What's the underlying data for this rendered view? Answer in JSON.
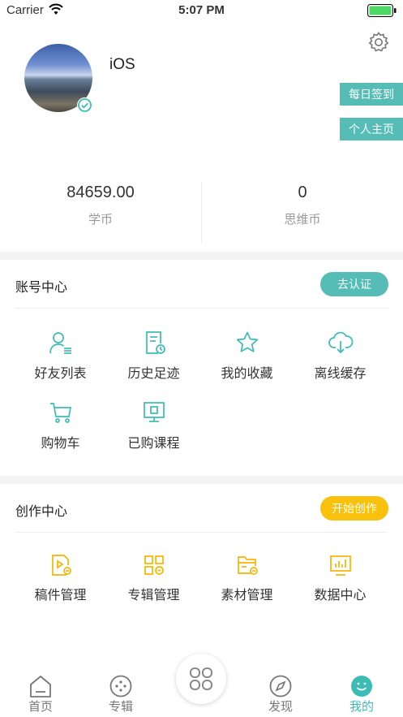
{
  "status_bar": {
    "carrier": "Carrier",
    "time": "5:07 PM"
  },
  "profile": {
    "username": "iOS",
    "daily_checkin_label": "每日签到",
    "homepage_label": "个人主页",
    "stats": [
      {
        "value": "84659.00",
        "label": "学币"
      },
      {
        "value": "0",
        "label": "思维币"
      }
    ]
  },
  "account_center": {
    "title": "账号中心",
    "action_label": "去认证",
    "accent_color": "#55bdb6",
    "items": [
      {
        "label": "好友列表",
        "icon": "friends-list-icon"
      },
      {
        "label": "历史足迹",
        "icon": "history-icon"
      },
      {
        "label": "我的收藏",
        "icon": "star-icon"
      },
      {
        "label": "离线缓存",
        "icon": "cloud-download-icon"
      },
      {
        "label": "购物车",
        "icon": "cart-icon"
      },
      {
        "label": "已购课程",
        "icon": "purchased-course-icon"
      }
    ]
  },
  "creation_center": {
    "title": "创作中心",
    "action_label": "开始创作",
    "accent_color": "#f9c00c",
    "items": [
      {
        "label": "稿件管理",
        "icon": "manuscript-icon"
      },
      {
        "label": "专辑管理",
        "icon": "album-grid-icon"
      },
      {
        "label": "素材管理",
        "icon": "material-folder-icon"
      },
      {
        "label": "数据中心",
        "icon": "data-chart-icon"
      }
    ]
  },
  "tab_bar": {
    "tabs": [
      {
        "label": "首页",
        "icon": "home-icon"
      },
      {
        "label": "专辑",
        "icon": "album-icon"
      },
      {
        "label": "发现",
        "icon": "compass-icon"
      },
      {
        "label": "我的",
        "icon": "profile-smile-icon"
      }
    ],
    "center_icon": "center-apps-icon",
    "active_color": "#3bbdb5"
  }
}
